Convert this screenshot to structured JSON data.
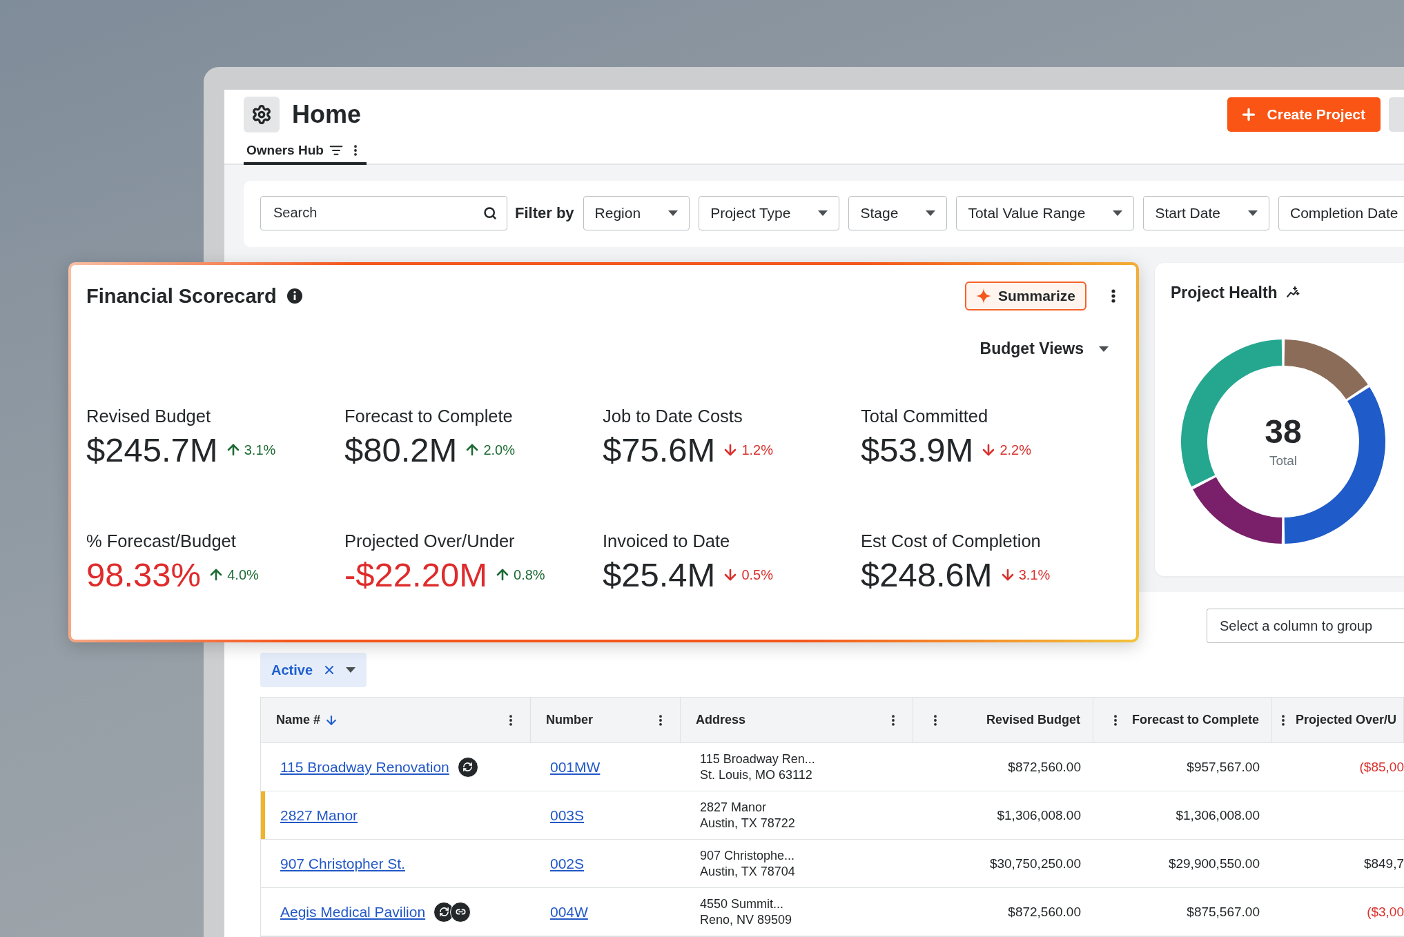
{
  "header": {
    "title": "Home",
    "create_button": "Create Project"
  },
  "tabs": [
    {
      "label": "Owners Hub",
      "selected": true
    }
  ],
  "filters": {
    "search": {
      "placeholder": "Search"
    },
    "label": "Filter by",
    "dropdowns": [
      "Region",
      "Project Type",
      "Stage",
      "Total Value Range",
      "Start Date",
      "Completion Date"
    ]
  },
  "scorecard": {
    "title": "Financial Scorecard",
    "summarize": "Summarize",
    "view_select": "Budget Views",
    "metrics": [
      {
        "label": "Revised Budget",
        "value": "$245.7M",
        "alert": false,
        "change": "3.1%",
        "rising": true
      },
      {
        "label": "Forecast to Complete",
        "value": "$80.2M",
        "alert": false,
        "change": "2.0%",
        "rising": true
      },
      {
        "label": "Job to Date Costs",
        "value": "$75.6M",
        "alert": false,
        "change": "1.2%",
        "rising": false
      },
      {
        "label": "Total Committed",
        "value": "$53.9M",
        "alert": false,
        "change": "2.2%",
        "rising": false
      },
      {
        "label": "% Forecast/Budget",
        "value": "98.33%",
        "alert": true,
        "change": "4.0%",
        "rising": true
      },
      {
        "label": "Projected Over/Under",
        "value": "-$22.20M",
        "alert": true,
        "change": "0.8%",
        "rising": true
      },
      {
        "label": "Invoiced to Date",
        "value": "$25.4M",
        "alert": false,
        "change": "0.5%",
        "rising": false
      },
      {
        "label": "Est Cost of Completion",
        "value": "$248.6M",
        "alert": false,
        "change": "3.1%",
        "rising": false
      }
    ]
  },
  "project_health": {
    "title": "Project Health",
    "total": "38",
    "total_label": "Total"
  },
  "table": {
    "group_select": {
      "placeholder": "Select a column to group"
    },
    "chips": [
      {
        "label": "Active"
      }
    ],
    "columns": [
      {
        "label": "Name #",
        "sorted": true
      },
      {
        "label": "Number",
        "sorted": false
      },
      {
        "label": "Address",
        "sorted": false
      },
      {
        "label": "Revised Budget",
        "sorted": false
      },
      {
        "label": "Forecast to Complete",
        "sorted": false
      },
      {
        "label": "Projected Over/U",
        "sorted": false
      }
    ],
    "rows": [
      {
        "name": "115 Broadway Renovation",
        "badges": [
          {
            "kind": "sync"
          }
        ],
        "flagged": false,
        "number": "001MW",
        "address": [
          "115 Broadway Ren...",
          "St. Louis, MO 63112"
        ],
        "revised_budget": "$872,560.00",
        "forecast": "$957,567.00",
        "projected": "($85,00",
        "negative": true
      },
      {
        "name": "2827 Manor",
        "badges": [],
        "flagged": true,
        "number": "003S",
        "address": [
          "2827 Manor",
          "Austin, TX 78722"
        ],
        "revised_budget": "$1,306,008.00",
        "forecast": "$1,306,008.00"
      },
      {
        "name": "907 Christopher St.",
        "badges": [],
        "flagged": false,
        "number": "002S",
        "address": [
          "907 Christophe...",
          "Austin, TX 78704"
        ],
        "revised_budget": "$30,750,250.00",
        "forecast": "$29,900,550.00",
        "projected": "$849,7",
        "negative": false
      },
      {
        "name": "Aegis Medical Pavilion",
        "badges": [
          {
            "kind": "sync"
          },
          {
            "kind": "link"
          }
        ],
        "flagged": false,
        "number": "004W",
        "address": [
          "4550 Summit...",
          "Reno, NV 89509"
        ],
        "revised_budget": "$872,560.00",
        "forecast": "$875,567.00",
        "projected": "($3,00",
        "negative": true
      }
    ]
  }
}
